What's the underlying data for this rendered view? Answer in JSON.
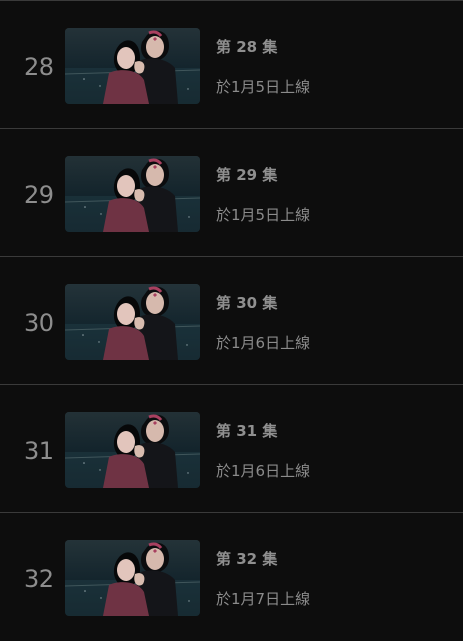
{
  "episodes": [
    {
      "number": "28",
      "title": "第 28 集",
      "release": "於1月5日上線"
    },
    {
      "number": "29",
      "title": "第 29 集",
      "release": "於1月5日上線"
    },
    {
      "number": "30",
      "title": "第 30 集",
      "release": "於1月6日上線"
    },
    {
      "number": "31",
      "title": "第 31 集",
      "release": "於1月6日上線"
    },
    {
      "number": "32",
      "title": "第 32 集",
      "release": "於1月7日上線"
    }
  ]
}
